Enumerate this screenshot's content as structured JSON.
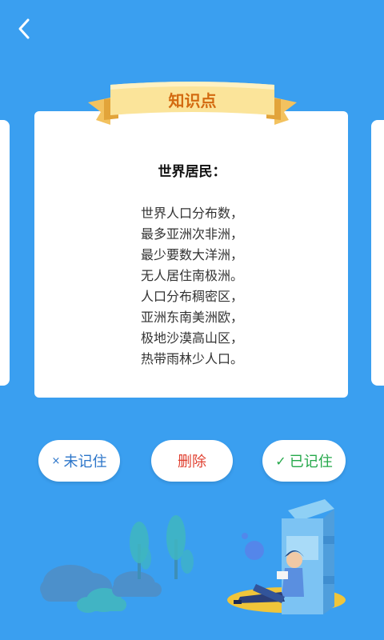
{
  "header": {
    "back_icon": "chevron-left-icon"
  },
  "ribbon": {
    "title": "知识点"
  },
  "card": {
    "title": "世界居民：",
    "lines": [
      "世界人口分布数，",
      "最多亚洲次非洲，",
      "最少要数大洋洲，",
      "无人居住南极洲。",
      "人口分布稠密区，",
      "亚洲东南美洲欧，",
      "极地沙漠高山区，",
      "热带雨林少人口。"
    ]
  },
  "actions": {
    "forget": {
      "icon": "×",
      "label": "未记住",
      "color": "#2b75c9"
    },
    "delete": {
      "label": "删除",
      "color": "#e04030"
    },
    "remember": {
      "icon": "✓",
      "label": "已记住",
      "color": "#24a84a"
    }
  },
  "colors": {
    "background": "#3a9ff0",
    "ribbon": "#fbe49a",
    "ribbon_text": "#d36a10"
  }
}
